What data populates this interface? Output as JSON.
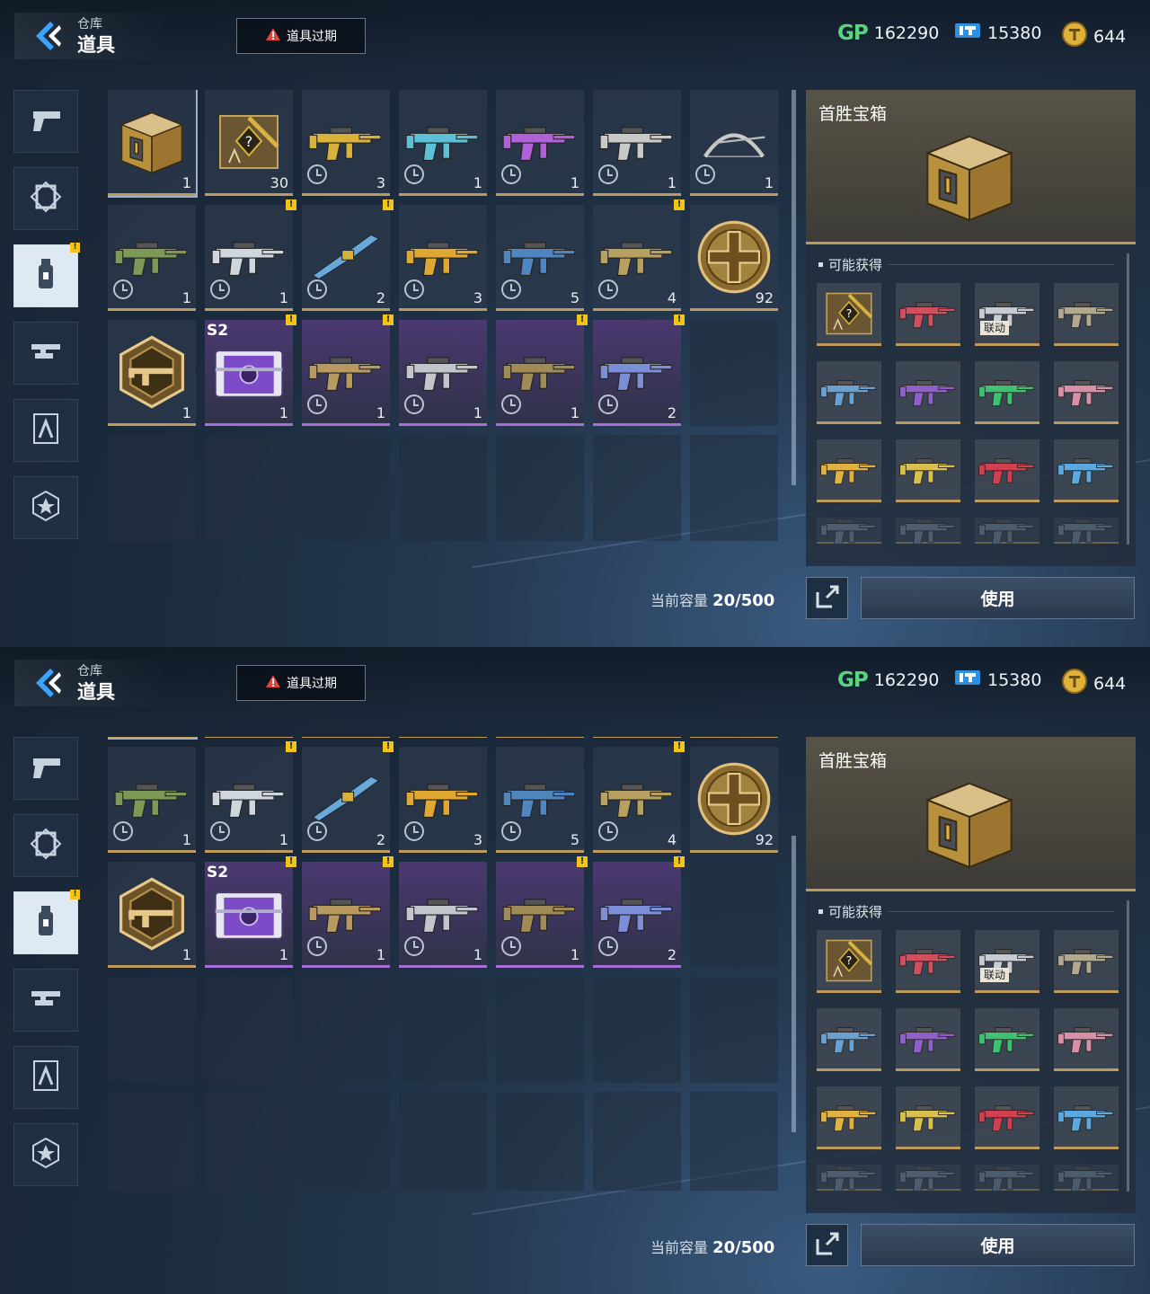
{
  "header": {
    "back_sub": "仓库",
    "back_title": "道具",
    "expire_label": "道具过期"
  },
  "currency": {
    "gp_mark": "GP",
    "gp": "162290",
    "tickets": "15380",
    "coins": "644"
  },
  "sidebar": {
    "tabs": [
      {
        "icon": "pistol-icon"
      },
      {
        "icon": "frame-icon"
      },
      {
        "icon": "spray-can-icon",
        "active": true,
        "badge": "!"
      },
      {
        "icon": "weapon-mod-icon"
      },
      {
        "icon": "compass-blueprint-icon"
      },
      {
        "icon": "star-medal-icon"
      }
    ]
  },
  "inventory": [
    {
      "count": "1",
      "kind": "chest",
      "selected": true
    },
    {
      "count": "30",
      "kind": "blueprint"
    },
    {
      "count": "3",
      "kind": "gun",
      "timed": true,
      "color": "#d8b23a"
    },
    {
      "count": "1",
      "kind": "gun",
      "timed": true,
      "color": "#5cc0d8"
    },
    {
      "count": "1",
      "kind": "gun",
      "timed": true,
      "color": "#b060d8"
    },
    {
      "count": "1",
      "kind": "gun",
      "timed": true,
      "color": "#c9c9c9"
    },
    {
      "count": "1",
      "kind": "bow",
      "timed": true,
      "color": "#c9c9c9"
    },
    {
      "count": "1",
      "kind": "gun",
      "timed": true,
      "color": "#7c9a55"
    },
    {
      "count": "1",
      "kind": "gun",
      "timed": true,
      "badge": "!",
      "color": "#d0d6de"
    },
    {
      "count": "2",
      "kind": "knife",
      "timed": true,
      "badge": "!",
      "color": "#6aa8d8"
    },
    {
      "count": "3",
      "kind": "gun",
      "timed": true,
      "color": "#e0a830"
    },
    {
      "count": "5",
      "kind": "gun",
      "timed": true,
      "color": "#4f86c0"
    },
    {
      "count": "4",
      "kind": "gun",
      "timed": true,
      "badge": "!",
      "color": "#b8a060"
    },
    {
      "count": "92",
      "kind": "coin"
    },
    {
      "count": "1",
      "kind": "badge-rifle"
    },
    {
      "count": "1",
      "kind": "s2-chest",
      "tag": "S2",
      "badge": "!",
      "rarity": "purple"
    },
    {
      "count": "1",
      "kind": "gun",
      "timed": true,
      "badge": "!",
      "rarity": "purple",
      "color": "#b89a60"
    },
    {
      "count": "1",
      "kind": "gun",
      "timed": true,
      "rarity": "purple",
      "color": "#c0c6cc"
    },
    {
      "count": "1",
      "kind": "gun",
      "timed": true,
      "badge": "!",
      "rarity": "purple",
      "color": "#a08a55"
    },
    {
      "count": "2",
      "kind": "gun",
      "timed": true,
      "badge": "!",
      "rarity": "purple",
      "color": "#7c8ed8"
    }
  ],
  "capacity": {
    "label": "当前容量 ",
    "value": "20/500"
  },
  "detail": {
    "title": "首胜宝箱",
    "possible_label": "可能获得",
    "rewards": [
      {
        "kind": "blueprint",
        "color": "#d8b23a"
      },
      {
        "kind": "gun",
        "color": "#d05060"
      },
      {
        "kind": "gun",
        "color": "#c8ccd2",
        "tag": "联动"
      },
      {
        "kind": "gun",
        "color": "#b0a890"
      },
      {
        "kind": "gun",
        "color": "#6aa0d0"
      },
      {
        "kind": "gun",
        "color": "#9060c8"
      },
      {
        "kind": "gun",
        "color": "#40c070"
      },
      {
        "kind": "gun",
        "color": "#d890a8"
      },
      {
        "kind": "gun",
        "color": "#e0b040"
      },
      {
        "kind": "gun",
        "color": "#d8c050"
      },
      {
        "kind": "gun",
        "color": "#d04050"
      },
      {
        "kind": "gun",
        "color": "#5ca8e0"
      },
      {
        "kind": "gun",
        "color": "#8090a0"
      },
      {
        "kind": "gun",
        "color": "#8090a0"
      },
      {
        "kind": "gun",
        "color": "#8090a0"
      },
      {
        "kind": "gun",
        "color": "#8090a0"
      }
    ],
    "use_label": "使用"
  },
  "colors": {
    "gold": "#bd9b5e",
    "purple": "#a66fd8",
    "badge": "#f2c418",
    "gp": "#56d67c"
  }
}
